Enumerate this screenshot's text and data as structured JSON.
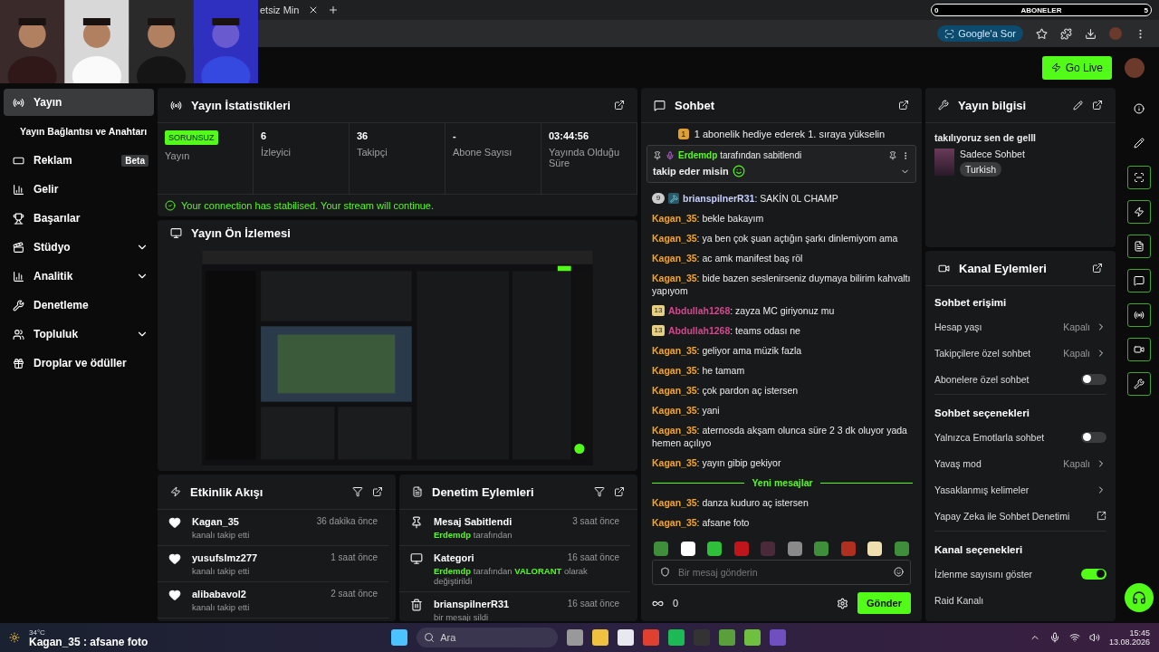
{
  "browser": {
    "tab_title": "etsiz Min",
    "ask_button": "Google'a Sor"
  },
  "overlay": {
    "counter_label": "ABONELER",
    "counter_start": "0",
    "counter_end": "5"
  },
  "header": {
    "go_live": "Go Live"
  },
  "sidebar": {
    "items": [
      {
        "label": "Yayın",
        "kind": "main",
        "selected": true
      },
      {
        "label": "Yayın Bağlantısı ve Anahtarı",
        "kind": "sub",
        "selected": false
      },
      {
        "label": "Reklam",
        "kind": "main",
        "selected": false,
        "badge": "Beta"
      },
      {
        "label": "Gelir",
        "kind": "main",
        "selected": false
      },
      {
        "label": "Başarılar",
        "kind": "main",
        "selected": false
      },
      {
        "label": "Stüdyo",
        "kind": "group",
        "selected": false
      },
      {
        "label": "Analitik",
        "kind": "group",
        "selected": false
      },
      {
        "label": "Denetleme",
        "kind": "main",
        "selected": false
      },
      {
        "label": "Topluluk",
        "kind": "group",
        "selected": false
      },
      {
        "label": "Droplar ve ödüller",
        "kind": "main",
        "selected": false
      }
    ]
  },
  "stats": {
    "title": "Yayın İstatistikleri",
    "status": "SORUNSUZ",
    "status_label": "Yayın",
    "items": [
      {
        "value": "6",
        "label": "İzleyici"
      },
      {
        "value": "36",
        "label": "Takipçi"
      },
      {
        "value": "-",
        "label": "Abone Sayısı"
      },
      {
        "value": "03:44:56",
        "label": "Yayında Olduğu Süre"
      }
    ],
    "notice": "Your connection has stabilised. Your stream will continue."
  },
  "preview": {
    "title": "Yayın Ön İzlemesi"
  },
  "activity": {
    "title": "Etkinlik Akışı",
    "items": [
      {
        "name": "Kagan_35",
        "action": "kanalı takip etti",
        "time": "36 dakika önce"
      },
      {
        "name": "yusufslmz277",
        "action": "kanalı takip etti",
        "time": "1 saat önce"
      },
      {
        "name": "alibabavol2",
        "action": "kanalı takip etti",
        "time": "2 saat önce"
      }
    ]
  },
  "moderation": {
    "title": "Denetim Eylemleri",
    "items": [
      {
        "kind": "pin",
        "title": "Mesaj Sabitlendi",
        "time": "3 saat önce",
        "detail": [
          {
            "text": "Erdemdp",
            "highlight": true
          },
          {
            "text": "tarafından",
            "highlight": false
          }
        ]
      },
      {
        "kind": "category",
        "title": "Kategori",
        "time": "16 saat önce",
        "detail": [
          {
            "text": "Erdemdp",
            "highlight": true
          },
          {
            "text": "tarafından",
            "highlight": false
          },
          {
            "text": "VALORANT",
            "highlight": true
          },
          {
            "text": "olarak değiştirildi",
            "highlight": false
          }
        ]
      },
      {
        "kind": "delete",
        "title": "brianspilnerR31",
        "time": "16 saat önce",
        "detail": [
          {
            "text": "bir mesajı sildi",
            "highlight": false
          }
        ]
      }
    ]
  },
  "chat": {
    "title": "Sohbet",
    "promo_badge": "1",
    "promo": "1 abonelik hediye ederek 1. sıraya yükselin",
    "pinned": {
      "user": "Erdemdp",
      "by": "tarafından sabitlendi",
      "text": "takip eder misin"
    },
    "messages": [
      {
        "user": "brianspilnerR31",
        "text": ": SAKİN 0L CHAMP",
        "color": "#c8d0ff",
        "badges": [
          {
            "kind": "round",
            "text": "9"
          },
          {
            "kind": "mod"
          }
        ]
      },
      {
        "user": "Kagan_35",
        "text": ": bekle bakayım",
        "color": "#f5a623"
      },
      {
        "user": "Kagan_35",
        "text": ": ya ben çok şuan açtığın şarkı dinlemiyom ama",
        "color": "#f5a623"
      },
      {
        "user": "Kagan_35",
        "text": ": ac amk manifest baş röl",
        "color": "#f5a623"
      },
      {
        "user": "Kagan_35",
        "text": ": bide bazen seslenirseniz duymaya bilirim kahvaltı yapıyom",
        "color": "#f5a623"
      },
      {
        "user": "Abdullah1268",
        "text": ": zayza MC giriyonuz mu",
        "color": "#d9448e",
        "badges": [
          {
            "kind": "square",
            "text": "13"
          }
        ]
      },
      {
        "user": "Abdullah1268",
        "text": ": teams odası ne",
        "color": "#d9448e",
        "badges": [
          {
            "kind": "square",
            "text": "13"
          }
        ]
      },
      {
        "user": "Kagan_35",
        "text": ": geliyor ama müzik fazla",
        "color": "#f5a623"
      },
      {
        "user": "Kagan_35",
        "text": ": he tamam",
        "color": "#f5a623"
      },
      {
        "user": "Kagan_35",
        "text": ": çok pardon aç istersen",
        "color": "#f5a623"
      },
      {
        "user": "Kagan_35",
        "text": ": yani",
        "color": "#f5a623"
      },
      {
        "user": "Kagan_35",
        "text": ": aternosda akşam olunca süre 2 3 dk oluyor yada hemen açılıyo",
        "color": "#f5a623"
      },
      {
        "user": "Kagan_35",
        "text": ": yayın gibip gekiyor",
        "color": "#f5a623"
      },
      {
        "kind": "divider",
        "text": "Yeni mesajlar"
      },
      {
        "user": "Kagan_35",
        "text": ": danza kuduro aç istersen",
        "color": "#f5a623"
      },
      {
        "user": "Kagan_35",
        "text": ": afsane foto",
        "color": "#f5a623"
      }
    ],
    "placeholder": "Bir mesaj gönderin",
    "points": "0",
    "send": "Gönder"
  },
  "stream_info": {
    "title": "Yayın bilgisi",
    "stream_title": "takılıyoruz sen de gelll",
    "category": "Sadece Sohbet",
    "tag": "Turkish"
  },
  "channel_actions": {
    "title": "Kanal Eylemleri",
    "sections": [
      {
        "title": "Sohbet erişimi",
        "rows": [
          {
            "kind": "value",
            "label": "Hesap yaşı",
            "value": "Kapalı"
          },
          {
            "kind": "value",
            "label": "Takipçilere özel sohbet",
            "value": "Kapalı"
          },
          {
            "kind": "toggle",
            "label": "Abonelere özel sohbet",
            "checked": false
          }
        ]
      },
      {
        "title": "Sohbet seçenekleri",
        "rows": [
          {
            "kind": "toggle",
            "label": "Yalnızca Emotlarla sohbet",
            "checked": false
          },
          {
            "kind": "value",
            "label": "Yavaş mod",
            "value": "Kapalı"
          },
          {
            "kind": "link",
            "label": "Yasaklanmış kelimeler"
          },
          {
            "kind": "external",
            "label": "Yapay Zeka ile Sohbet Denetimi"
          }
        ]
      },
      {
        "title": "Kanal seçenekleri",
        "rows": [
          {
            "kind": "toggle",
            "label": "İzlenme sayısını göster",
            "checked": true
          },
          {
            "kind": "plain",
            "label": "Raid Kanalı"
          }
        ]
      }
    ]
  },
  "taskbar": {
    "weather": "34°C",
    "overlay_message": "Kagan_35 : afsane foto",
    "search": "Ara",
    "time": "15:45",
    "date": "13.08.2026"
  }
}
